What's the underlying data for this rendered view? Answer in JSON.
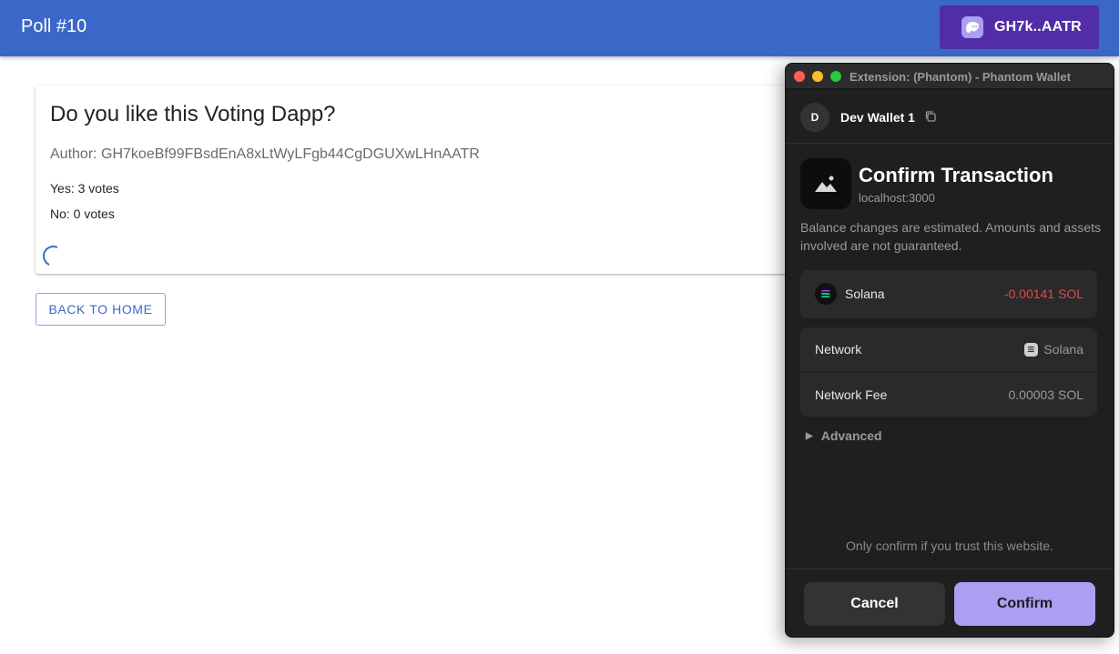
{
  "app": {
    "title": "Poll #10",
    "wallet_button": "GH7k..AATR"
  },
  "poll": {
    "question": "Do you like this Voting Dapp?",
    "author": "Author: GH7koeBf99FBsdEnA8xLtWyLFgb44CgDGUXwLHnAATR",
    "yes": "Yes: 3 votes",
    "no": "No: 0 votes"
  },
  "back_button": "BACK TO HOME",
  "phantom": {
    "window_title": "Extension: (Phantom) - Phantom Wallet",
    "account_initial": "D",
    "account_name": "Dev Wallet 1",
    "heading": "Confirm Transaction",
    "origin": "localhost:3000",
    "note": "Balance changes are estimated. Amounts and assets involved are not guaranteed.",
    "balance": {
      "token": "Solana",
      "change": "-0.00141 SOL"
    },
    "network": {
      "label": "Network",
      "value": "Solana"
    },
    "fee": {
      "label": "Network Fee",
      "value": "0.00003 SOL"
    },
    "advanced": "Advanced",
    "trust_note": "Only confirm if you trust this website.",
    "cancel": "Cancel",
    "confirm": "Confirm"
  },
  "colors": {
    "appbar": "#3b68c8",
    "wallet_button": "#512da8",
    "phantom_purple": "#ab9ff2",
    "negative": "#e5484d"
  },
  "icons": [
    "phantom-ghost-icon",
    "copy-icon",
    "image-placeholder-icon",
    "solana-icon",
    "triangle-right-icon",
    "progress-spinner"
  ]
}
